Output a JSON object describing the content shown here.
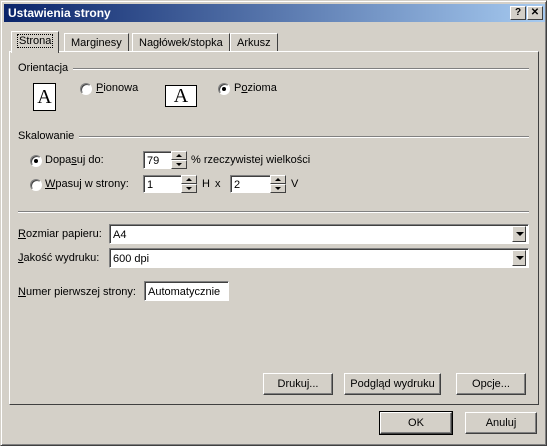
{
  "window": {
    "title": "Ustawienia strony",
    "help_glyph": "?",
    "close_glyph": "✕"
  },
  "tabs": [
    {
      "label": "Strona"
    },
    {
      "label": "Marginesy"
    },
    {
      "label": "Nagłówek/stopka"
    },
    {
      "label": "Arkusz"
    }
  ],
  "orientation": {
    "group_label": "Orientacja",
    "icon_glyph": "A",
    "portrait_label_u": "P",
    "portrait_label_rest": "ionowa",
    "landscape_label_u": "o",
    "landscape_label_pre": "P",
    "landscape_label_rest": "zioma",
    "selected": "landscape"
  },
  "scaling": {
    "group_label": "Skalowanie",
    "adjust_label_pre": "Dopa",
    "adjust_label_u": "s",
    "adjust_label_rest": "uj do:",
    "adjust_value": "79",
    "adjust_suffix": "% rzeczywistej wielkości",
    "fit_label_u": "W",
    "fit_label_rest": "pasuj w strony:",
    "fit_wide": "1",
    "fit_wide_suffix": "H",
    "times": "x",
    "fit_tall": "2",
    "fit_tall_suffix": "V",
    "selected": "adjust"
  },
  "paper": {
    "size_label_u": "R",
    "size_label_rest": "ozmiar papieru:",
    "size_value": "A4",
    "quality_label_u": "J",
    "quality_label_rest": "akość wydruku:",
    "quality_value": "600 dpi",
    "first_page_label_u": "N",
    "first_page_label_rest": "umer pierwszej strony:",
    "first_page_value": "Automatycznie"
  },
  "buttons": {
    "print": "Drukuj...",
    "preview": "Podgląd wydruku",
    "options": "Opcje...",
    "ok": "OK",
    "cancel": "Anuluj"
  }
}
